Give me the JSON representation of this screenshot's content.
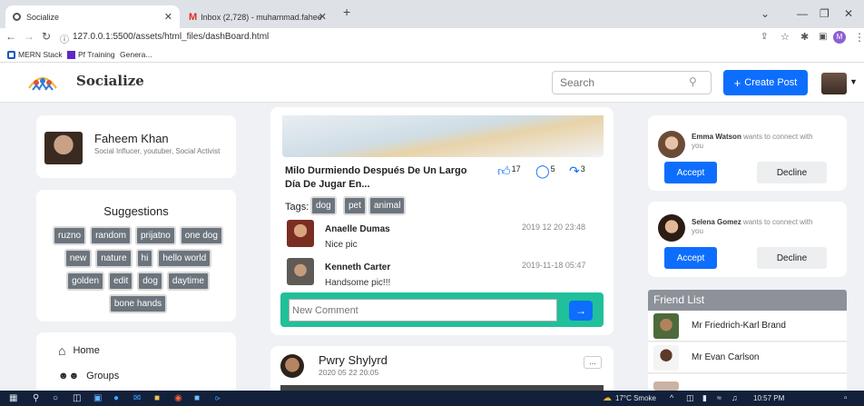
{
  "browser": {
    "tabs": [
      {
        "title": "Socialize",
        "active": true
      },
      {
        "title": "Inbox (2,728) - muhammad.fahee",
        "active": false
      }
    ],
    "url": "127.0.0.1:5500/assets/html_files/dashBoard.html",
    "bookmarks": [
      "MERN Stack",
      "Pf Training",
      "Genera..."
    ],
    "profile_initial": "M"
  },
  "navbar": {
    "brand": "Socialize",
    "search_placeholder": "Search",
    "create_post_label": "Create Post"
  },
  "profile": {
    "name": "Faheem Khan",
    "description": "Social Influcer, youtuber, Social Activist"
  },
  "suggestions": {
    "title": "Suggestions",
    "tags": [
      "ruzno",
      "random",
      "prijatno",
      "one dog",
      "new",
      "nature",
      "hi",
      "hello world",
      "golden",
      "edit",
      "dog",
      "daytime",
      "bone hands"
    ]
  },
  "sidenav": {
    "items": [
      {
        "label": "Home",
        "icon": "home-icon"
      },
      {
        "label": "Groups",
        "icon": "groups-icon"
      }
    ]
  },
  "post": {
    "title": "Milo Durmiendo Después De Un Largo Día De Jugar En...",
    "likes": "17",
    "comments_count": "5",
    "shares": "3",
    "tags_label": "Tags:",
    "tags": [
      "dog",
      "pet",
      "animal"
    ],
    "comments": [
      {
        "name": "Anaelle Dumas",
        "date": "2019 12 20 23:48",
        "text": "Nice pic"
      },
      {
        "name": "Kenneth Carter",
        "date": "2019-11-18 05:47",
        "text": "Handsome pic!!!"
      }
    ],
    "comment_placeholder": "New Comment"
  },
  "post2": {
    "name": "Pwry Shylyrd",
    "date": "2020 05 22 20:05",
    "more_label": "..."
  },
  "requests": [
    {
      "name": "Emma Watson",
      "text": "wants to connect with you",
      "accept": "Accept",
      "decline": "Decline"
    },
    {
      "name": "Selena Gomez",
      "text": "wants to connect with you",
      "accept": "Accept",
      "decline": "Decline"
    }
  ],
  "friend_list": {
    "title": "Friend List",
    "friends": [
      "Mr Friedrich-Karl Brand",
      "Mr Evan Carlson"
    ]
  },
  "taskbar": {
    "weather": "17°C Smoke",
    "time": "10:57 PM"
  },
  "colors": {
    "primary": "#0d6efd",
    "comment_bar": "#20c09a",
    "tag_bg": "#6c757d"
  }
}
